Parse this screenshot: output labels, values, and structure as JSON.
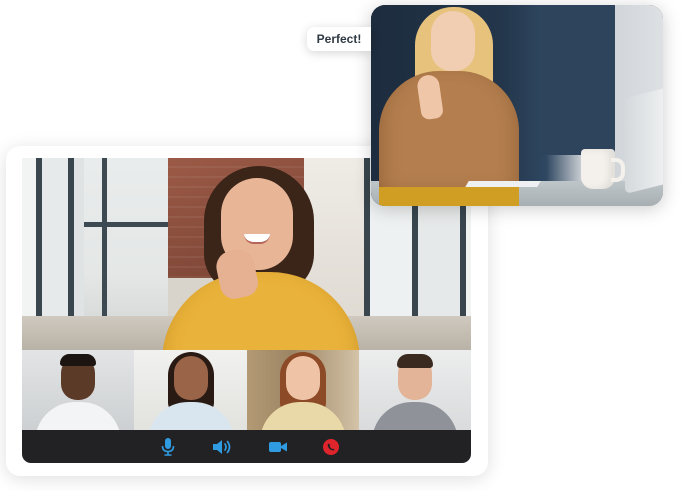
{
  "chat": {
    "message": "Perfect!"
  },
  "controls": {
    "mic_icon": "microphone-icon",
    "speaker_icon": "speaker-icon",
    "camera_icon": "video-camera-icon",
    "end_call_icon": "phone-end-icon"
  },
  "colors": {
    "control_bar": "#222224",
    "icon_blue": "#2f9be0",
    "end_call_red": "#e0242c"
  }
}
